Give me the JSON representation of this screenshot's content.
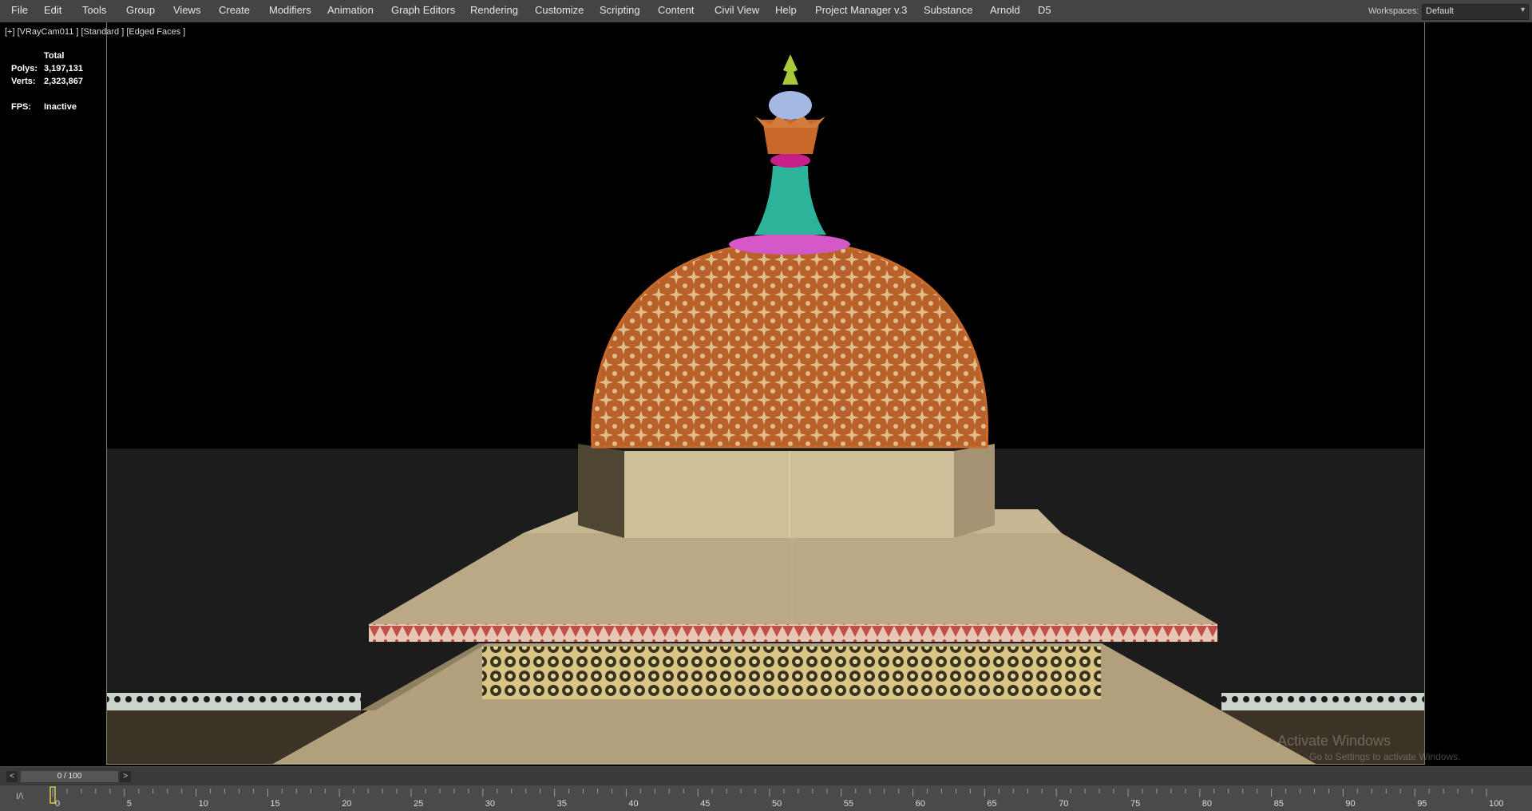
{
  "menu": {
    "items": [
      "File",
      "Edit",
      "Tools",
      "Group",
      "Views",
      "Create",
      "Modifiers",
      "Animation",
      "Graph Editors",
      "Rendering",
      "Customize",
      "Scripting",
      "Content",
      "Civil View",
      "Help",
      "Project Manager v.3",
      "Substance",
      "Arnold",
      "D5"
    ],
    "workspace_label": "Workspaces:",
    "workspace_value": "Default"
  },
  "viewport": {
    "label": "[+] [VRayCam011 ] [Standard ] [Edged Faces ]",
    "stats": {
      "total_label": "Total",
      "polys_label": "Polys:",
      "polys_value": "3,197,131",
      "verts_label": "Verts:",
      "verts_value": "2,323,867",
      "fps_label": "FPS:",
      "fps_value": "Inactive"
    }
  },
  "watermark": {
    "title": "Activate Windows",
    "subtitle": "Go to Settings to activate Windows."
  },
  "timeslider": {
    "prev": "<",
    "frame": "0 / 100",
    "next": ">"
  },
  "trackbar": {
    "icon": "I/\\",
    "ticks": [
      "0",
      "5",
      "10",
      "15",
      "20",
      "25",
      "30",
      "35",
      "40",
      "45",
      "50",
      "55",
      "60",
      "65",
      "70",
      "75",
      "80",
      "85",
      "90",
      "95",
      "100"
    ]
  },
  "colors": {
    "dome": "#c8692a",
    "dome_pattern": "#e0b98a",
    "base_stone": "#bfae8a",
    "collar": "#d455c8",
    "neck": "#2cb39a",
    "finial_tip": "#a9c93a",
    "bulb": "#a6b9e4"
  }
}
